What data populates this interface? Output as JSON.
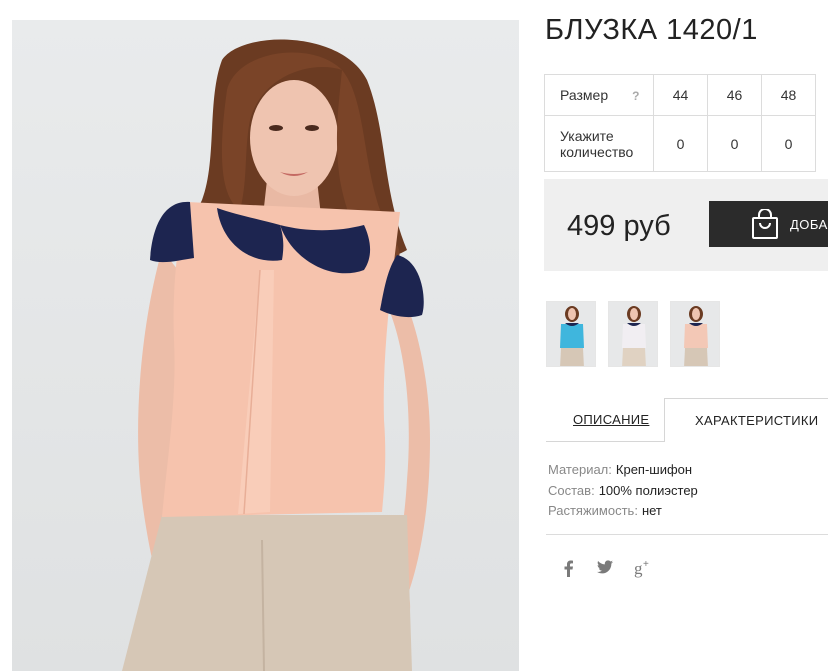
{
  "product": {
    "title": "БЛУЗКА 1420/1",
    "image_alt": "model-wearing-peach-blouse"
  },
  "size_table": {
    "size_label": "Размер",
    "help_mark": "?",
    "sizes": [
      "44",
      "46",
      "48"
    ],
    "qty_label_line1": "Укажите",
    "qty_label_line2": "количество",
    "quantities": [
      "0",
      "0",
      "0"
    ]
  },
  "price": {
    "text": "499 руб",
    "buy_label": "ДОБАВИТЬ"
  },
  "thumbnails": [
    {
      "color": "#3fb6dd",
      "name": "blue"
    },
    {
      "color": "#f1eef2",
      "name": "white"
    },
    {
      "color": "#f3c8b6",
      "name": "peach"
    }
  ],
  "tabs": {
    "description": "ОПИСАНИЕ",
    "characteristics": "ХАРАКТЕРИСТИКИ"
  },
  "characteristics": [
    {
      "key": "Материал:",
      "value": "Креп-шифон"
    },
    {
      "key": "Состав:",
      "value": "100% полиэстер"
    },
    {
      "key": "Растяжимость:",
      "value": "нет"
    }
  ],
  "social": {
    "facebook": "f",
    "twitter": "twitter",
    "google_plus": "g+"
  },
  "colors": {
    "blouse": "#f6c3ad",
    "collar": "#1d2550",
    "button_bg": "#2b2b2b",
    "price_bg": "#efefef"
  }
}
